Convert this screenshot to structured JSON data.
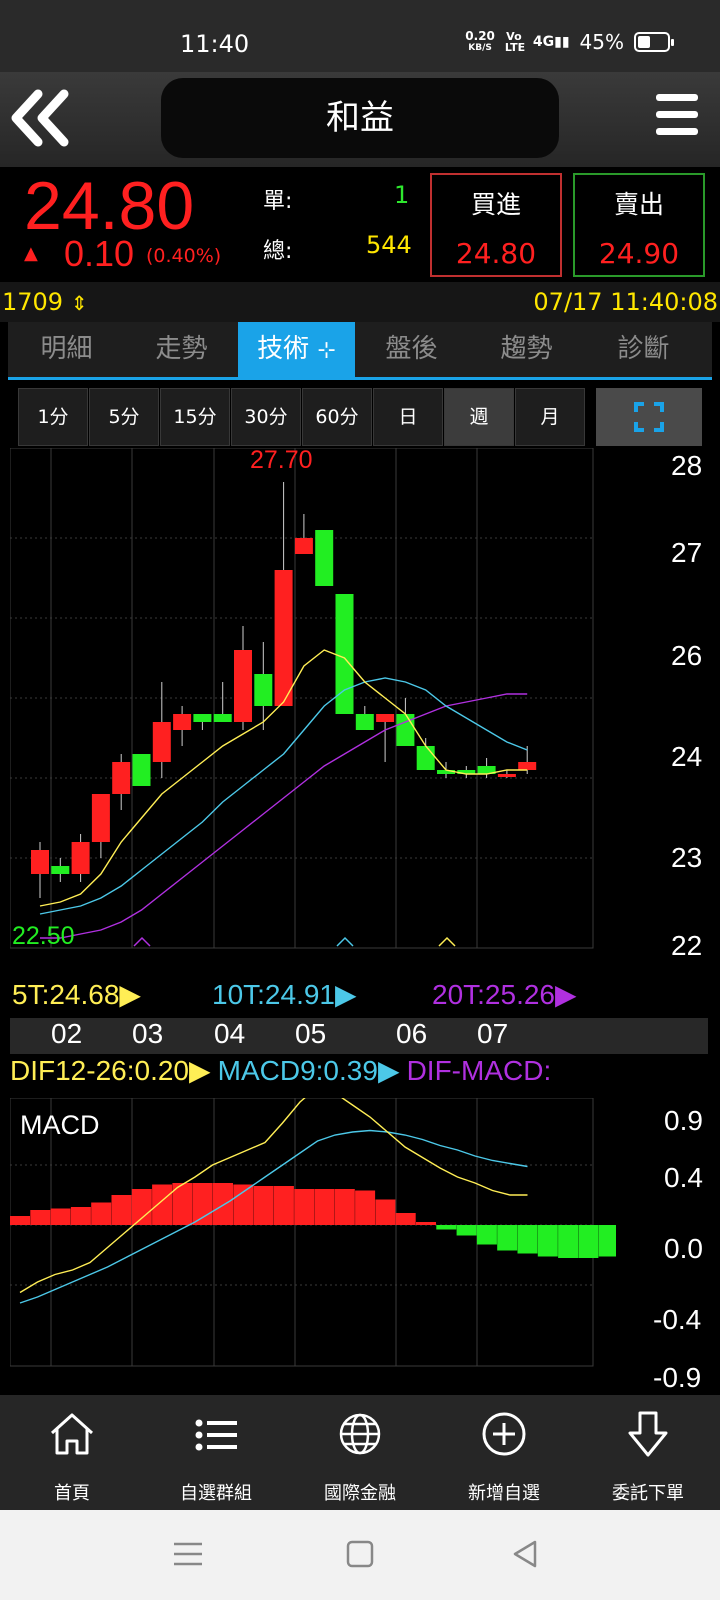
{
  "status": {
    "time": "11:40",
    "speed_value": "0.20",
    "speed_unit": "KB/S",
    "volte": "Vo LTE",
    "signal": "4G",
    "battery": "45%"
  },
  "header": {
    "title": "和益"
  },
  "quote": {
    "price": "24.80",
    "arrow": "▲",
    "change": "0.10",
    "change_pct": "(0.40%)",
    "single_label": "單:",
    "single_value": "1",
    "total_label": "總:",
    "total_value": "544",
    "buy_label": "買進",
    "buy_price": "24.80",
    "sell_label": "賣出",
    "sell_price": "24.90"
  },
  "info": {
    "volume": "1709",
    "datetime": "07/17 11:40:08"
  },
  "tabs": [
    "明細",
    "走勢",
    "技術",
    "盤後",
    "趨勢",
    "診斷"
  ],
  "active_tab": "技術",
  "periods": [
    "1分",
    "5分",
    "15分",
    "30分",
    "60分",
    "日",
    "週",
    "月"
  ],
  "active_period": "週",
  "price_axis": [
    "28",
    "27",
    "26",
    "24",
    "23",
    "22"
  ],
  "high_label": "27.70",
  "low_label": "22.50",
  "ma_legend": {
    "ma5": "5T:24.68",
    "ma10": "10T:24.91",
    "ma20": "20T:25.26"
  },
  "months": [
    "02",
    "03",
    "04",
    "05",
    "06",
    "07"
  ],
  "macd_legend": {
    "dif": "DIF12-26:0.20",
    "macd": "MACD9:0.39",
    "osc": "DIF-MACD:"
  },
  "macd_title": "MACD",
  "macd_axis": [
    "0.9",
    "0.4",
    "0.0",
    "-0.4",
    "-0.9"
  ],
  "colors": {
    "up": "#ff2020",
    "down": "#22ee22",
    "accent": "#1aa3e8",
    "ma5": "#ffee55",
    "ma10": "#4cc8e8",
    "ma20": "#b030e0"
  },
  "chart_data": [
    {
      "type": "candlestick",
      "title": "",
      "ylim": [
        22,
        28
      ],
      "candles": [
        {
          "o": 22.8,
          "h": 23.2,
          "l": 22.5,
          "c": 23.1
        },
        {
          "o": 22.9,
          "h": 23.0,
          "l": 22.7,
          "c": 22.8
        },
        {
          "o": 22.8,
          "h": 23.3,
          "l": 22.7,
          "c": 23.2
        },
        {
          "o": 23.2,
          "h": 23.8,
          "l": 23.0,
          "c": 23.8
        },
        {
          "o": 23.8,
          "h": 24.3,
          "l": 23.6,
          "c": 24.2
        },
        {
          "o": 24.3,
          "h": 24.3,
          "l": 23.9,
          "c": 23.9
        },
        {
          "o": 24.2,
          "h": 25.2,
          "l": 24.0,
          "c": 24.7
        },
        {
          "o": 24.6,
          "h": 24.9,
          "l": 24.4,
          "c": 24.8
        },
        {
          "o": 24.8,
          "h": 24.8,
          "l": 24.6,
          "c": 24.7
        },
        {
          "o": 24.8,
          "h": 25.2,
          "l": 24.7,
          "c": 24.7
        },
        {
          "o": 24.7,
          "h": 25.9,
          "l": 24.6,
          "c": 25.6
        },
        {
          "o": 25.3,
          "h": 25.7,
          "l": 24.6,
          "c": 24.9
        },
        {
          "o": 24.9,
          "h": 27.7,
          "l": 24.9,
          "c": 26.6
        },
        {
          "o": 26.8,
          "h": 27.3,
          "l": 26.8,
          "c": 27.0
        },
        {
          "o": 27.1,
          "h": 27.1,
          "l": 26.4,
          "c": 26.4
        },
        {
          "o": 26.3,
          "h": 26.3,
          "l": 24.8,
          "c": 24.8
        },
        {
          "o": 24.8,
          "h": 24.9,
          "l": 24.6,
          "c": 24.6
        },
        {
          "o": 24.7,
          "h": 24.8,
          "l": 24.2,
          "c": 24.8
        },
        {
          "o": 24.8,
          "h": 25.0,
          "l": 24.4,
          "c": 24.4
        },
        {
          "o": 24.4,
          "h": 24.5,
          "l": 24.1,
          "c": 24.1
        },
        {
          "o": 24.1,
          "h": 24.2,
          "l": 24.0,
          "c": 24.05
        },
        {
          "o": 24.1,
          "h": 24.15,
          "l": 24.0,
          "c": 24.05
        },
        {
          "o": 24.15,
          "h": 24.25,
          "l": 24.0,
          "c": 24.05
        },
        {
          "o": 24.05,
          "h": 24.1,
          "l": 24.0,
          "c": 24.05
        },
        {
          "o": 24.1,
          "h": 24.4,
          "l": 24.05,
          "c": 24.2
        }
      ],
      "ma5": [
        22.4,
        22.45,
        22.55,
        22.8,
        23.2,
        23.5,
        23.8,
        24.0,
        24.2,
        24.4,
        24.55,
        24.7,
        24.95,
        25.4,
        25.6,
        25.5,
        25.2,
        25.0,
        24.8,
        24.4,
        24.1,
        24.05,
        24.05,
        24.1,
        24.1
      ],
      "ma10": [
        22.3,
        22.35,
        22.4,
        22.5,
        22.65,
        22.85,
        23.05,
        23.25,
        23.45,
        23.7,
        23.9,
        24.1,
        24.3,
        24.6,
        24.9,
        25.1,
        25.2,
        25.25,
        25.2,
        25.1,
        24.9,
        24.75,
        24.6,
        24.45,
        24.35
      ],
      "ma20": [
        22.0,
        22.0,
        22.05,
        22.1,
        22.2,
        22.35,
        22.55,
        22.75,
        22.95,
        23.15,
        23.35,
        23.55,
        23.75,
        23.95,
        24.15,
        24.3,
        24.45,
        24.6,
        24.7,
        24.8,
        24.9,
        24.95,
        25.0,
        25.05,
        25.05
      ]
    },
    {
      "type": "bar",
      "title": "MACD",
      "ylim": [
        -0.9,
        0.9
      ],
      "osc": [
        0.06,
        0.1,
        0.11,
        0.12,
        0.15,
        0.2,
        0.24,
        0.27,
        0.28,
        0.28,
        0.28,
        0.27,
        0.26,
        0.26,
        0.24,
        0.24,
        0.24,
        0.23,
        0.17,
        0.08,
        0.02,
        -0.03,
        -0.07,
        -0.13,
        -0.17,
        -0.19,
        -0.21,
        -0.22,
        -0.22,
        -0.21
      ],
      "dif": [
        -0.45,
        -0.38,
        -0.33,
        -0.3,
        -0.25,
        -0.15,
        -0.05,
        0.05,
        0.15,
        0.25,
        0.32,
        0.4,
        0.45,
        0.5,
        0.55,
        0.68,
        0.82,
        0.92,
        0.88,
        0.8,
        0.72,
        0.62,
        0.52,
        0.45,
        0.38,
        0.32,
        0.28,
        0.23,
        0.2,
        0.2
      ],
      "macd": [
        -0.52,
        -0.48,
        -0.43,
        -0.38,
        -0.33,
        -0.28,
        -0.22,
        -0.16,
        -0.1,
        -0.04,
        0.02,
        0.09,
        0.16,
        0.24,
        0.32,
        0.4,
        0.48,
        0.56,
        0.6,
        0.62,
        0.63,
        0.62,
        0.6,
        0.57,
        0.53,
        0.5,
        0.46,
        0.43,
        0.41,
        0.39
      ]
    }
  ]
}
